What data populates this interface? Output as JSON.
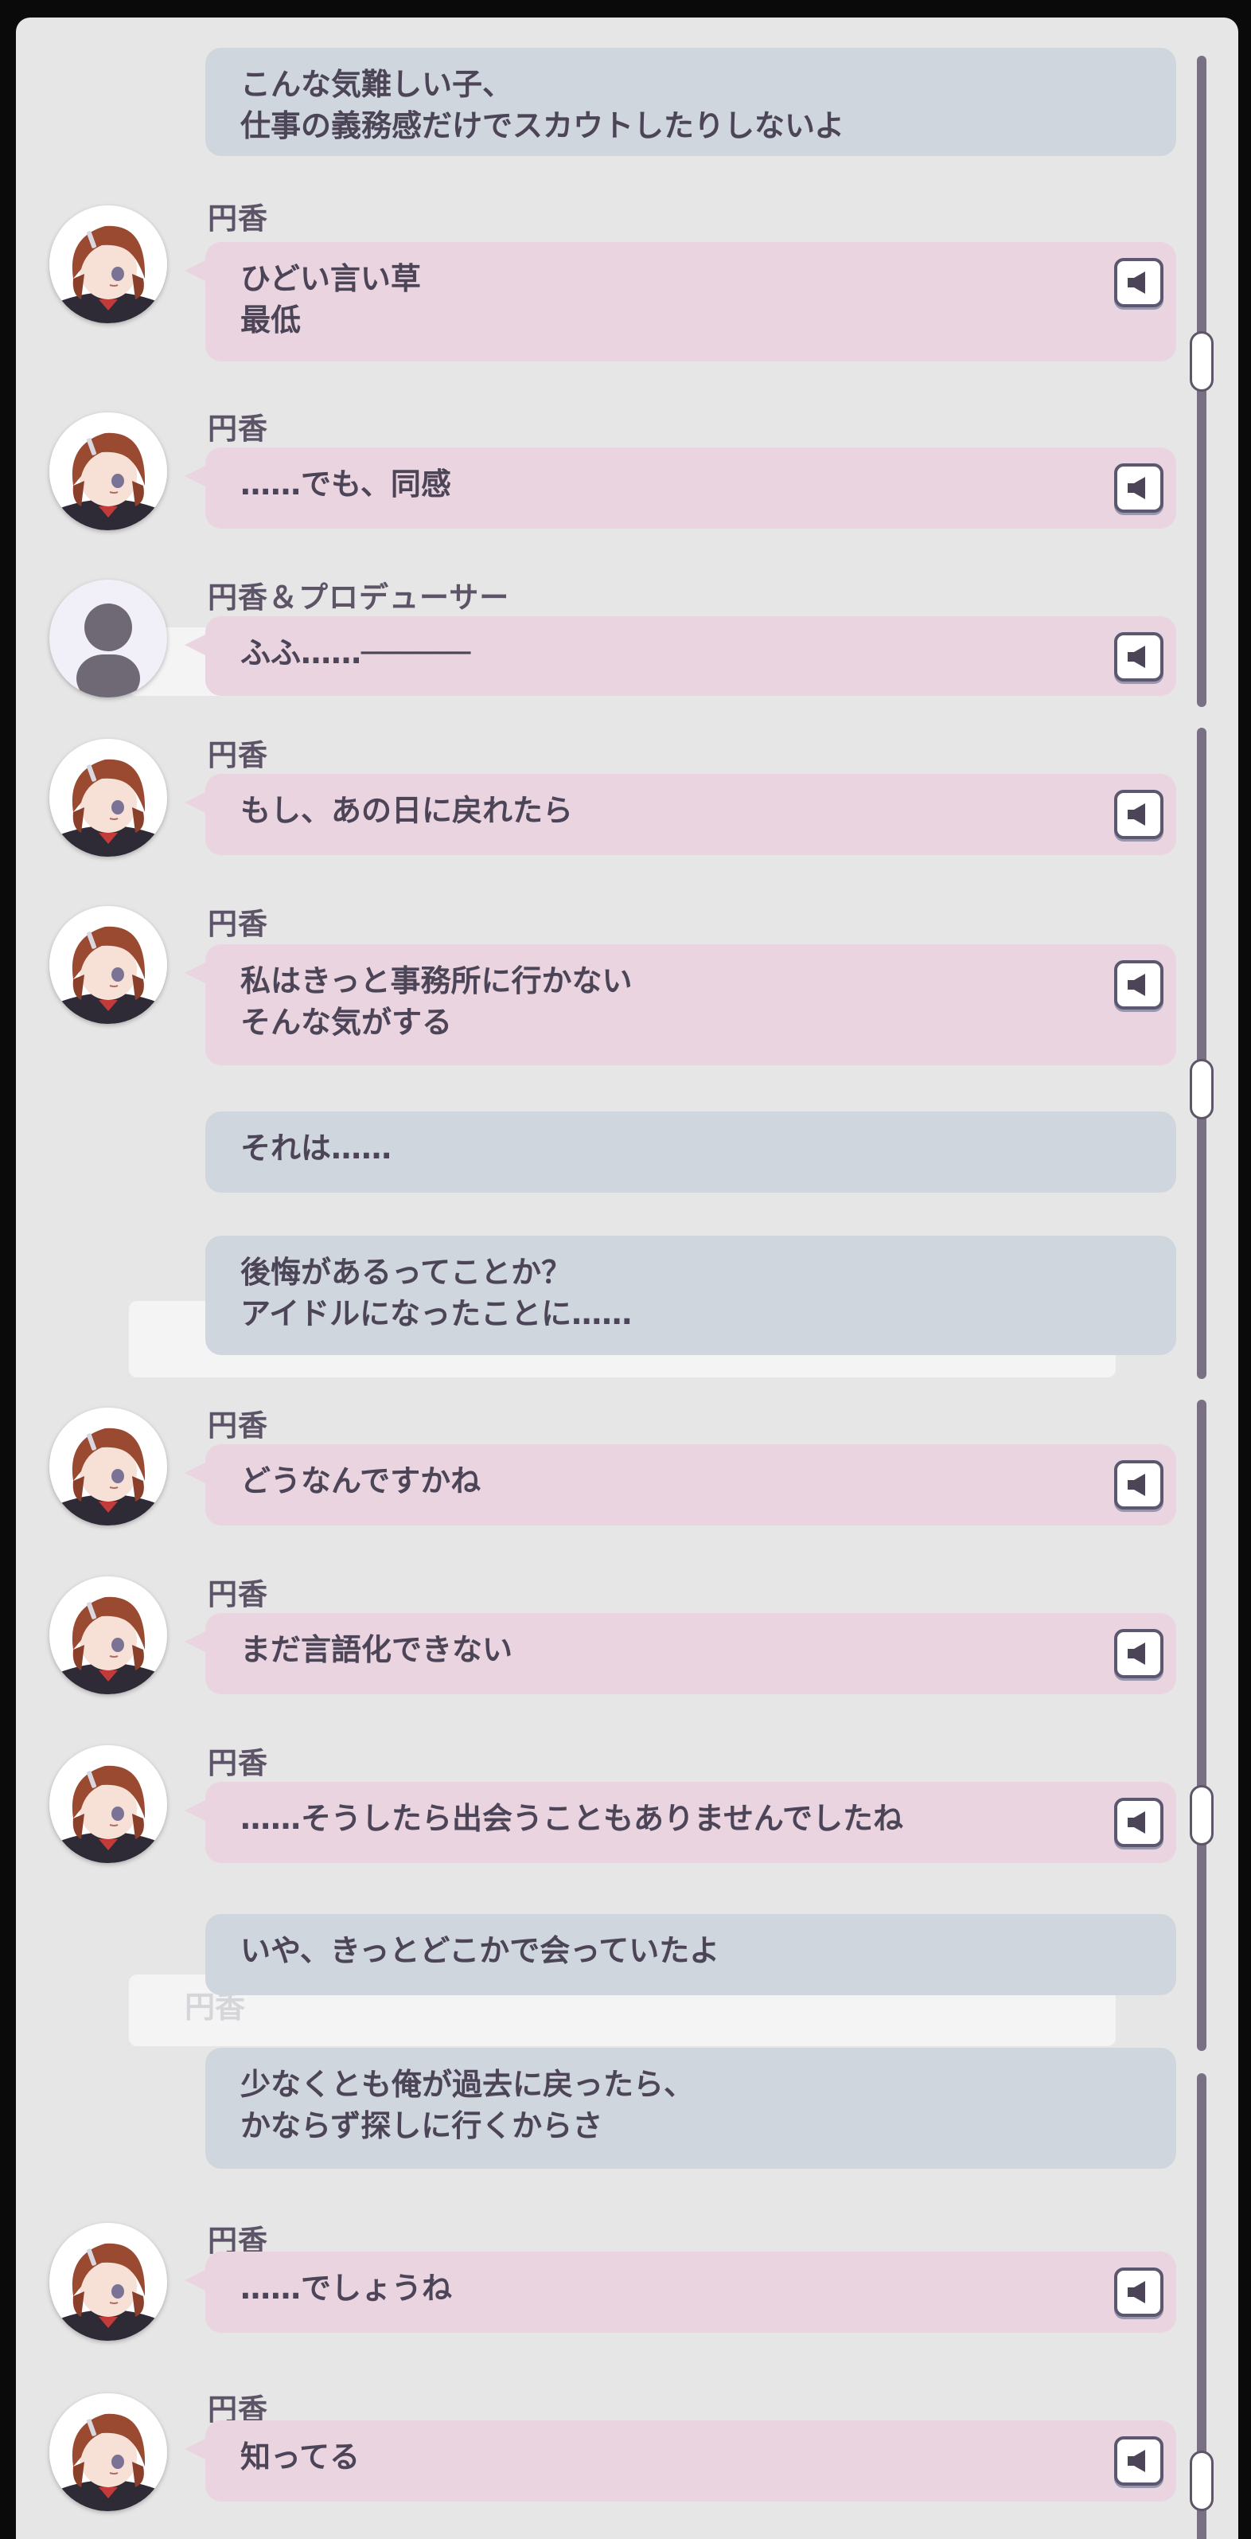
{
  "messages": [
    {
      "speaker": "",
      "type": "producer",
      "lines": [
        "こんな気難しい子、",
        "仕事の義務感だけでスカウトしたりしないよ"
      ]
    },
    {
      "speaker": "円香",
      "type": "idol",
      "lines": [
        "ひどい言い草",
        "最低"
      ]
    },
    {
      "speaker": "円香",
      "type": "idol",
      "lines": [
        "……でも、同感"
      ]
    },
    {
      "speaker": "円香＆プロデューサー",
      "type": "both",
      "lines": [
        "ふふ……──────"
      ]
    },
    {
      "speaker": "円香",
      "type": "idol",
      "lines": [
        "もし、あの日に戻れたら"
      ]
    },
    {
      "speaker": "円香",
      "type": "idol",
      "lines": [
        "私はきっと事務所に行かない",
        "そんな気がする"
      ]
    },
    {
      "speaker": "",
      "type": "producer",
      "lines": [
        "それは……"
      ]
    },
    {
      "speaker": "",
      "type": "producer",
      "lines": [
        "後悔があるってことか？",
        "アイドルになったことに……"
      ]
    },
    {
      "speaker": "円香",
      "type": "idol",
      "lines": [
        "どうなんですかね"
      ]
    },
    {
      "speaker": "円香",
      "type": "idol",
      "lines": [
        "まだ言語化できない"
      ]
    },
    {
      "speaker": "円香",
      "type": "idol",
      "lines": [
        "……そうしたら出会うこともありませんでしたね"
      ]
    },
    {
      "speaker": "",
      "type": "producer",
      "lines": [
        "いや、きっとどこかで会っていたよ"
      ]
    },
    {
      "speaker": "",
      "type": "producer",
      "lines": [
        "少なくとも俺が過去に戻ったら、",
        "かならず探しに行くからさ"
      ]
    },
    {
      "speaker": "円香",
      "type": "idol",
      "lines": [
        "……でしょうね"
      ]
    },
    {
      "speaker": "円香",
      "type": "idol",
      "lines": [
        "知ってる"
      ]
    }
  ],
  "ghost_label": "円香",
  "icons": {
    "voice": "speaker-icon",
    "avatar_idol": "madoka-avatar-icon",
    "avatar_both": "silhouette-icon"
  },
  "colors": {
    "idol_bubble": "#ead4df",
    "producer_bubble": "#d0d6dd",
    "text": "#4c4558",
    "panel": "#e6e6e6"
  }
}
